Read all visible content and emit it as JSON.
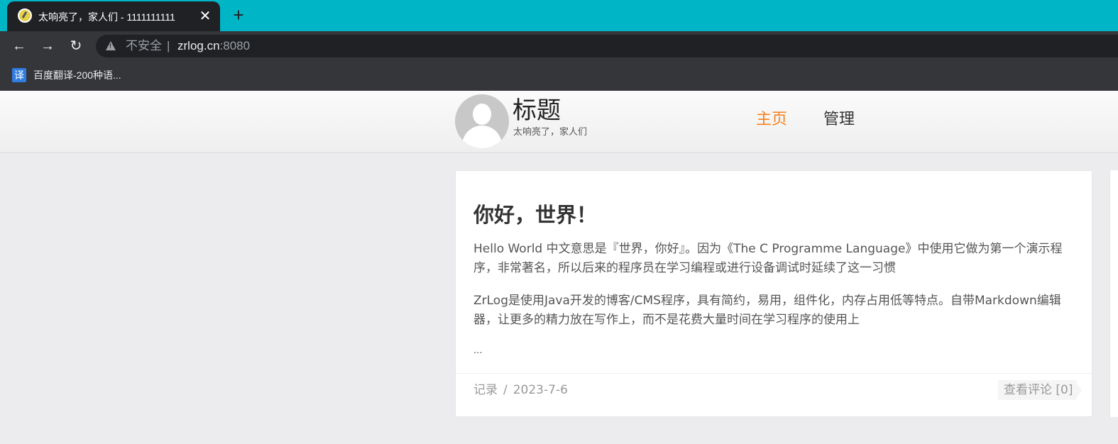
{
  "browser": {
    "tab": {
      "title": "太响亮了，家人们 - 1111111111",
      "close_glyph": "✕"
    },
    "new_tab_glyph": "+",
    "toolbar": {
      "back_glyph": "←",
      "forward_glyph": "→",
      "reload_glyph": "↻"
    },
    "address": {
      "security_label": "不安全",
      "separator": "|",
      "host": "zrlog.cn",
      "port": ":8080"
    },
    "bookmarks": [
      {
        "icon_text": "译",
        "label": "百度翻译-200种语..."
      }
    ]
  },
  "site": {
    "title": "标题",
    "subtitle": "太响亮了，家人们",
    "nav": [
      {
        "label": "主页",
        "active": true
      },
      {
        "label": "管理",
        "active": false
      }
    ]
  },
  "post": {
    "title": "你好，世界！",
    "paragraphs": [
      "Hello World 中文意思是『世界，你好』。因为《The C Programme Language》中使用它做为第一个演示程序，非常著名，所以后来的程序员在学习编程或进行设备调试时延续了这一习惯",
      "ZrLog是使用Java开发的博客/CMS程序，具有简约，易用，组件化，内存占用低等特点。自带Markdown编辑器，让更多的精力放在写作上，而不是花费大量时间在学习程序的使用上"
    ],
    "ellipsis": "...",
    "meta": {
      "category": "记录",
      "separator": "/",
      "date": "2023-7-6"
    },
    "comments_label": "查看评论 [0]"
  },
  "colors": {
    "tabbar": "#00b6c6",
    "nav_active": "#f7801b",
    "page_bg": "#ececee"
  }
}
